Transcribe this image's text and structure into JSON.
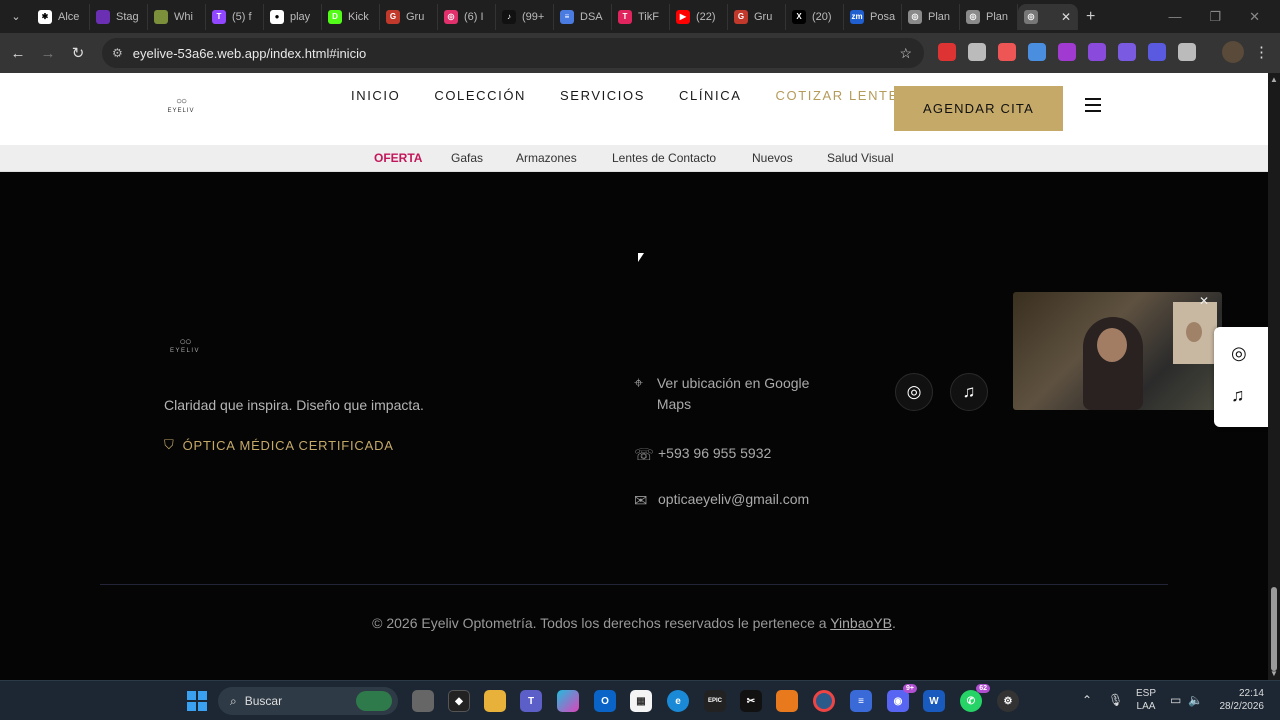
{
  "browser": {
    "tabs": [
      {
        "label": "Alce",
        "color": "#ffffff",
        "glyph": "✱"
      },
      {
        "label": "Stag",
        "color": "#6b2fb3",
        "glyph": ""
      },
      {
        "label": "Whi",
        "color": "#7c8f3a",
        "glyph": ""
      },
      {
        "label": "(5) f",
        "color": "#9146ff",
        "glyph": "T"
      },
      {
        "label": "play",
        "color": "#ffffff",
        "glyph": "●"
      },
      {
        "label": "Kick",
        "color": "#53fc18",
        "glyph": "D"
      },
      {
        "label": "Gru",
        "color": "#c0392b",
        "glyph": "G"
      },
      {
        "label": "(6) I",
        "color": "#e1306c",
        "glyph": "◎"
      },
      {
        "label": "(99+",
        "color": "#111111",
        "glyph": "♪"
      },
      {
        "label": "DSA",
        "color": "#4a7be0",
        "glyph": "≡"
      },
      {
        "label": "TikF",
        "color": "#e0245e",
        "glyph": "T"
      },
      {
        "label": "(22)",
        "color": "#ff0000",
        "glyph": "▶"
      },
      {
        "label": "Gru",
        "color": "#c0392b",
        "glyph": "G"
      },
      {
        "label": "(20)",
        "color": "#000000",
        "glyph": "X"
      },
      {
        "label": "Posa",
        "color": "#1f5fd0",
        "glyph": "zm"
      },
      {
        "label": "Plan",
        "color": "#8a8a8a",
        "glyph": "◎"
      },
      {
        "label": "Plan",
        "color": "#8a8a8a",
        "glyph": "◎"
      }
    ],
    "url": "eyelive-53a6e.web.app/index.html#inicio",
    "extensions": [
      "#d33",
      "#bbb",
      "#e55",
      "#4a8ee0",
      "#a03ad0",
      "#8a4bdc",
      "#7a5ae0",
      "#5a5ae0",
      "#bbb"
    ]
  },
  "header": {
    "logo_word": "EYELIV",
    "nav": [
      "INICIO",
      "COLECCIÓN",
      "SERVICIOS",
      "CLÍNICA",
      "COTIZAR LENTES"
    ],
    "cta": "AGENDAR CITA"
  },
  "subnav": [
    "OFERTA",
    "Gafas",
    "Armazones",
    "Lentes de Contacto",
    "Nuevos",
    "Salud Visual"
  ],
  "footer": {
    "logo_word": "EYELIV",
    "tagline": "Claridad que inspira. Diseño que impacta.",
    "certification": "ÓPTICA MÉDICA CERTIFICADA",
    "map_link": "Ver ubicación en Google Maps",
    "phone": "+593 96 955 5932",
    "email": "opticaeyeliv@gmail.com",
    "copyright": "© 2026 Eyeliv Optometría. Todos los derechos reservados le pertenece a ",
    "author": "YinbaoYB",
    "period": "."
  },
  "taskbar": {
    "search_label": "Buscar",
    "lang_1": "ESP",
    "lang_2": "LAA",
    "time": "22:14",
    "date": "28/2/2026",
    "discord_badge": "9+",
    "whatsapp_badge": "62"
  },
  "colors": {
    "gold": "#c5a969",
    "offer": "#c2185b"
  }
}
